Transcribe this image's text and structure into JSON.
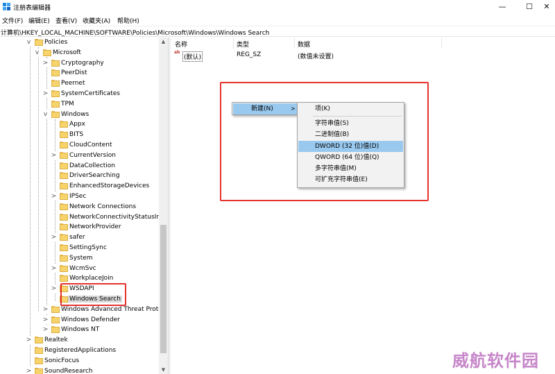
{
  "window": {
    "title": "注册表编辑器",
    "minimize": "—",
    "maximize": "☐",
    "close": "✕"
  },
  "menu": [
    "文件(F)",
    "编辑(E)",
    "查看(V)",
    "收藏夹(A)",
    "帮助(H)"
  ],
  "address": "计算机\\HKEY_LOCAL_MACHINE\\SOFTWARE\\Policies\\Microsoft\\Windows\\Windows Search",
  "tree": [
    {
      "label": "Policies",
      "expander": "v"
    },
    {
      "label": "Microsoft",
      "expander": "v"
    },
    {
      "label": "Cryptography",
      "expander": ">"
    },
    {
      "label": "PeerDist",
      "expander": ""
    },
    {
      "label": "Peernet",
      "expander": ""
    },
    {
      "label": "SystemCertificates",
      "expander": ">"
    },
    {
      "label": "TPM",
      "expander": ""
    },
    {
      "label": "Windows",
      "expander": "v"
    },
    {
      "label": "Appx",
      "expander": ""
    },
    {
      "label": "BITS",
      "expander": ""
    },
    {
      "label": "CloudContent",
      "expander": ""
    },
    {
      "label": "CurrentVersion",
      "expander": ">"
    },
    {
      "label": "DataCollection",
      "expander": ""
    },
    {
      "label": "DriverSearching",
      "expander": ""
    },
    {
      "label": "EnhancedStorageDevices",
      "expander": ""
    },
    {
      "label": "IPSec",
      "expander": ">"
    },
    {
      "label": "Network Connections",
      "expander": ""
    },
    {
      "label": "NetworkConnectivityStatusIndi",
      "expander": ""
    },
    {
      "label": "NetworkProvider",
      "expander": ""
    },
    {
      "label": "safer",
      "expander": ">"
    },
    {
      "label": "SettingSync",
      "expander": ""
    },
    {
      "label": "System",
      "expander": ""
    },
    {
      "label": "WcmSvc",
      "expander": ">"
    },
    {
      "label": "WorkplaceJoin",
      "expander": ""
    },
    {
      "label": "WSDAPI",
      "expander": ">"
    },
    {
      "label": "Windows Search",
      "expander": ""
    },
    {
      "label": "Windows Advanced Threat Prote",
      "expander": ">"
    },
    {
      "label": "Windows Defender",
      "expander": ">"
    },
    {
      "label": "Windows NT",
      "expander": ">"
    },
    {
      "label": "Realtek",
      "expander": ">"
    },
    {
      "label": "RegisteredApplications",
      "expander": ""
    },
    {
      "label": "SonicFocus",
      "expander": ""
    },
    {
      "label": "SoundResearch",
      "expander": ">"
    }
  ],
  "scroll": {
    "up": "▲",
    "down": "▼"
  },
  "columns": {
    "name": "名称",
    "type": "类型",
    "data": "数据"
  },
  "values": [
    {
      "icon": "ab",
      "name": "(默认)",
      "type": "REG_SZ",
      "data": "(数值未设置)"
    }
  ],
  "context_menu": {
    "new": "新建(N)",
    "arrow": ">",
    "sub": [
      "项(K)",
      "字符串值(S)",
      "二进制值(B)",
      "DWORD (32 位)值(D)",
      "QWORD (64 位)值(Q)",
      "多字符串值(M)",
      "可扩充字符串值(E)"
    ],
    "highlight_index": 3
  },
  "colors": {
    "highlight": "#99c9ef",
    "annotation_red": "#e5322d",
    "folder": "#f7d46b"
  },
  "watermark": "威航软件园"
}
